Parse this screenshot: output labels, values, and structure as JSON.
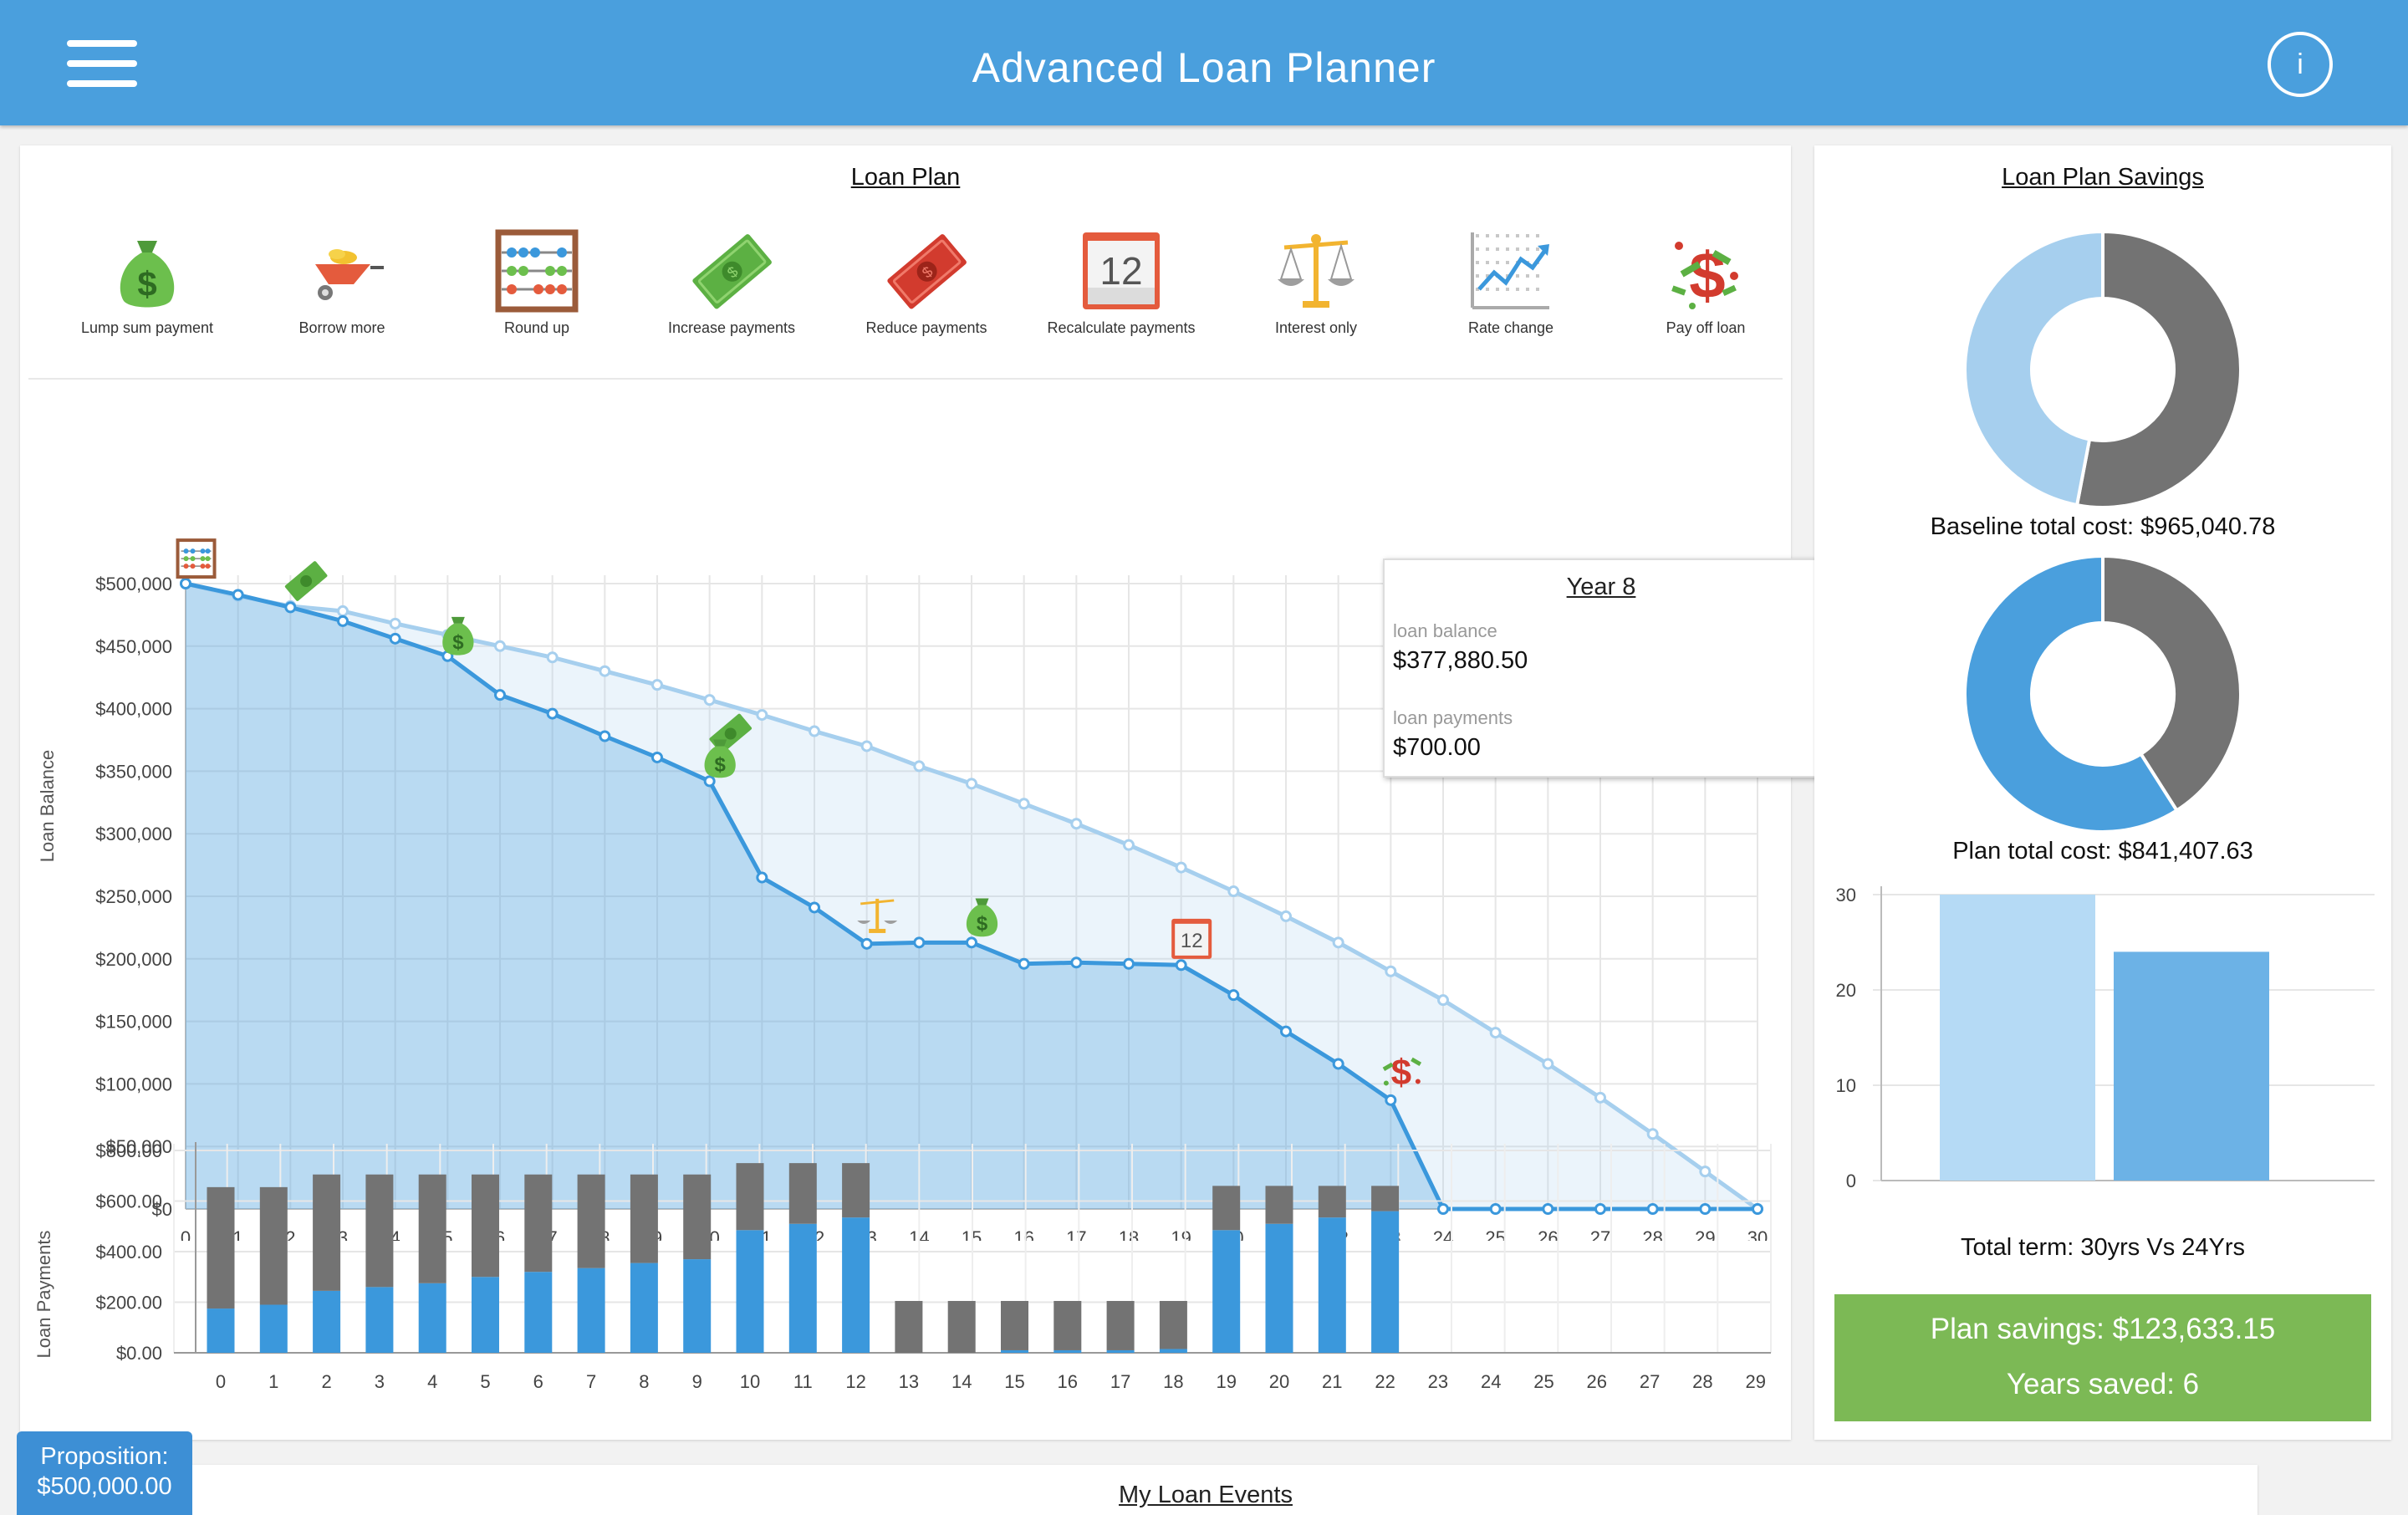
{
  "app": {
    "title": "Advanced Loan Planner",
    "info_label": "i"
  },
  "loan_plan": {
    "title": "Loan Plan",
    "tools": [
      {
        "label": "Lump sum payment",
        "icon": "money-bag-icon"
      },
      {
        "label": "Borrow more",
        "icon": "wheelbarrow-icon"
      },
      {
        "label": "Round up",
        "icon": "abacus-icon"
      },
      {
        "label": "Increase payments",
        "icon": "green-banknote-icon"
      },
      {
        "label": "Reduce payments",
        "icon": "red-banknote-icon"
      },
      {
        "label": "Recalculate payments",
        "icon": "calendar-icon"
      },
      {
        "label": "Interest only",
        "icon": "scales-icon"
      },
      {
        "label": "Rate change",
        "icon": "rate-chart-icon"
      },
      {
        "label": "Pay off loan",
        "icon": "pay-off-icon"
      }
    ],
    "calendar_number": "12"
  },
  "tooltip": {
    "title": "Year 8",
    "balance_label": "loan balance",
    "balance_value": "$377,880.50",
    "payments_label": "loan payments",
    "payments_value": "$700.00"
  },
  "savings": {
    "title": "Loan Plan Savings",
    "baseline_caption": "Baseline total cost: $965,040.78",
    "plan_caption": "Plan total cost: $841,407.63",
    "term_caption": "Total term: 30yrs Vs 24Yrs",
    "plan_savings": "Plan savings: $123,633.15",
    "years_saved": "Years saved: 6"
  },
  "proposition": {
    "label": "Proposition:",
    "value": "$500,000.00"
  },
  "events": {
    "title": "My Loan Events"
  },
  "colors": {
    "header": "#4a9fdd",
    "baseline": "#a6cfee",
    "plan": "#3b98dc",
    "interest": "#737373",
    "savings_green": "#7cb955"
  },
  "chart_data": [
    {
      "type": "line",
      "ylabel": "Loan Balance",
      "xlabel": "",
      "x": [
        0,
        1,
        2,
        3,
        4,
        5,
        6,
        7,
        8,
        9,
        10,
        11,
        12,
        13,
        14,
        15,
        16,
        17,
        18,
        19,
        20,
        21,
        22,
        23,
        24,
        25,
        26,
        27,
        28,
        29,
        30
      ],
      "ylim": [
        0,
        500000
      ],
      "yticks": [
        0,
        50000,
        100000,
        150000,
        200000,
        250000,
        300000,
        350000,
        400000,
        450000,
        500000
      ],
      "ytick_labels": [
        "$0",
        "$50,000",
        "$100,000",
        "$150,000",
        "$200,000",
        "$250,000",
        "$300,000",
        "$350,000",
        "$400,000",
        "$450,000",
        "$500,000"
      ],
      "grid": true,
      "series": [
        {
          "name": "",
          "values": [
            500000,
            490000,
            482000,
            478000,
            468000,
            459000,
            450000,
            441000,
            430000,
            419000,
            407000,
            395000,
            382000,
            370000,
            354000,
            340000,
            324000,
            308000,
            291000,
            273000,
            254000,
            234000,
            213000,
            190000,
            167000,
            141000,
            116000,
            89000,
            60000,
            30000,
            0
          ]
        },
        {
          "name": "",
          "values": [
            500000,
            491000,
            481000,
            470000,
            456000,
            442000,
            411000,
            396000,
            378000,
            361000,
            342000,
            265000,
            241000,
            212000,
            213000,
            213000,
            196000,
            197000,
            196000,
            195000,
            171000,
            142000,
            116000,
            87000,
            0,
            0,
            0,
            0,
            0,
            0,
            0
          ]
        }
      ],
      "event_markers": [
        {
          "x": 0.2,
          "y": 520000,
          "icon": "abacus-icon"
        },
        {
          "x": 2.3,
          "y": 502000,
          "icon": "green-banknote-icon"
        },
        {
          "x": 5.2,
          "y": 460000,
          "icon": "money-bag-icon"
        },
        {
          "x": 10.4,
          "y": 380000,
          "icon": "green-banknote-icon"
        },
        {
          "x": 10.2,
          "y": 362000,
          "icon": "money-bag-icon"
        },
        {
          "x": 13.2,
          "y": 236000,
          "icon": "scales-icon"
        },
        {
          "x": 15.2,
          "y": 235000,
          "icon": "money-bag-icon"
        },
        {
          "x": 19.2,
          "y": 216000,
          "icon": "calendar-icon"
        },
        {
          "x": 23.2,
          "y": 110000,
          "icon": "pay-off-icon"
        }
      ]
    },
    {
      "type": "bar",
      "ylabel": "Loan Payments",
      "xlabel": "",
      "categories": [
        "0",
        "1",
        "2",
        "3",
        "4",
        "5",
        "6",
        "7",
        "8",
        "9",
        "10",
        "11",
        "12",
        "13",
        "14",
        "15",
        "16",
        "17",
        "18",
        "19",
        "20",
        "21",
        "22",
        "23",
        "24",
        "25",
        "26",
        "27",
        "28",
        "29"
      ],
      "ylim": [
        0,
        800
      ],
      "ytick_labels": [
        "$0.00",
        "$200.00",
        "$400.00",
        "$600.00",
        "$800.00"
      ],
      "stacked": true,
      "series": [
        {
          "name": "",
          "values": [
            175,
            190,
            245,
            260,
            275,
            300,
            320,
            335,
            355,
            370,
            485,
            510,
            535,
            0,
            0,
            10,
            10,
            10,
            15,
            485,
            510,
            535,
            560,
            0,
            0,
            0,
            0,
            0,
            0,
            0
          ]
        },
        {
          "name": "",
          "values": [
            480,
            465,
            460,
            445,
            430,
            405,
            385,
            370,
            350,
            335,
            265,
            240,
            215,
            205,
            205,
            195,
            195,
            195,
            190,
            175,
            150,
            125,
            100,
            0,
            0,
            0,
            0,
            0,
            0,
            0
          ]
        }
      ],
      "grid": true
    },
    {
      "type": "pie",
      "donut": true,
      "values": [
        53,
        47
      ],
      "colors": [
        "#737373",
        "#a6cfee"
      ]
    },
    {
      "type": "pie",
      "donut": true,
      "values": [
        41,
        59
      ],
      "colors": [
        "#737373",
        "#4a9fdd"
      ]
    },
    {
      "type": "bar",
      "categories": [
        "",
        ""
      ],
      "values": [
        30,
        24
      ],
      "colors": [
        "#b5daf5",
        "#6cb2e6"
      ],
      "ylim": [
        0,
        30
      ],
      "ytick_labels": [
        "0",
        "10",
        "20",
        "30"
      ],
      "grid": true
    }
  ]
}
